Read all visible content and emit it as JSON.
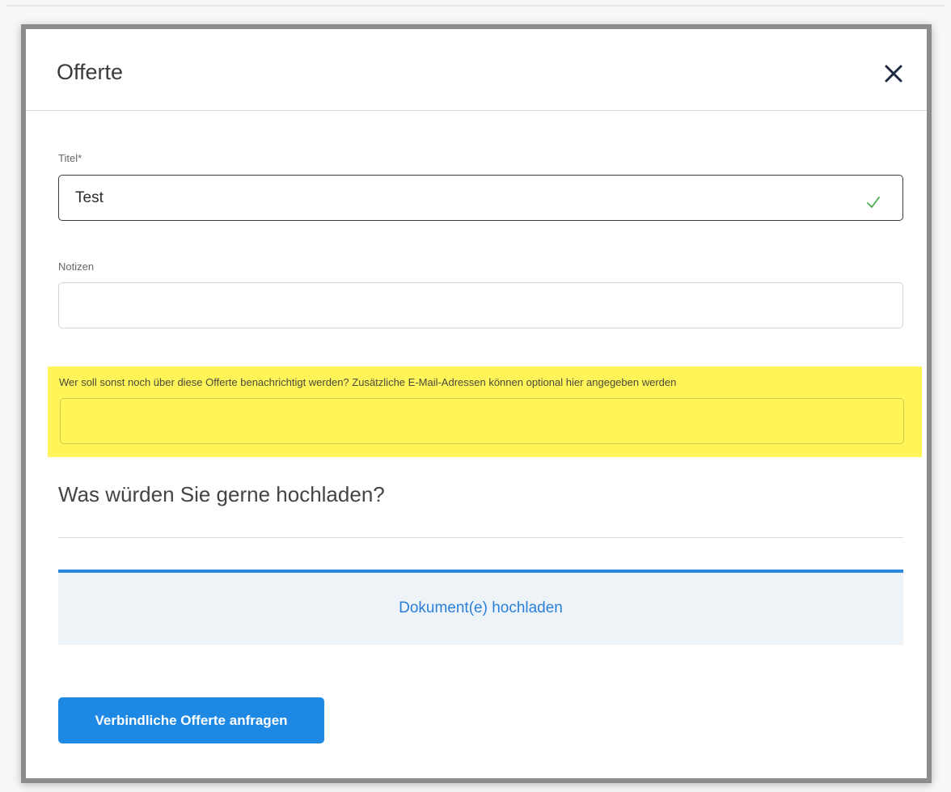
{
  "dialog": {
    "title": "Offerte",
    "close_icon": "close-icon"
  },
  "form": {
    "title_field": {
      "label": "Titel*",
      "value": "Test",
      "status_icon": "checkmark-icon"
    },
    "notes_field": {
      "label": "Notizen",
      "value": ""
    },
    "emails_field": {
      "label": "Wer soll sonst noch über diese Offerte benachrichtigt werden? Zusätzliche E-Mail-Adressen können optional hier angegeben werden",
      "value": ""
    }
  },
  "upload": {
    "heading": "Was würden Sie gerne hochladen?",
    "button_label": "Dokument(e) hochladen"
  },
  "actions": {
    "submit_label": "Verbindliche Offerte anfragen"
  },
  "colors": {
    "accent": "#1e88e5",
    "highlight": "#fff559",
    "valid": "#4caf50",
    "close_icon": "#1f2a44"
  }
}
